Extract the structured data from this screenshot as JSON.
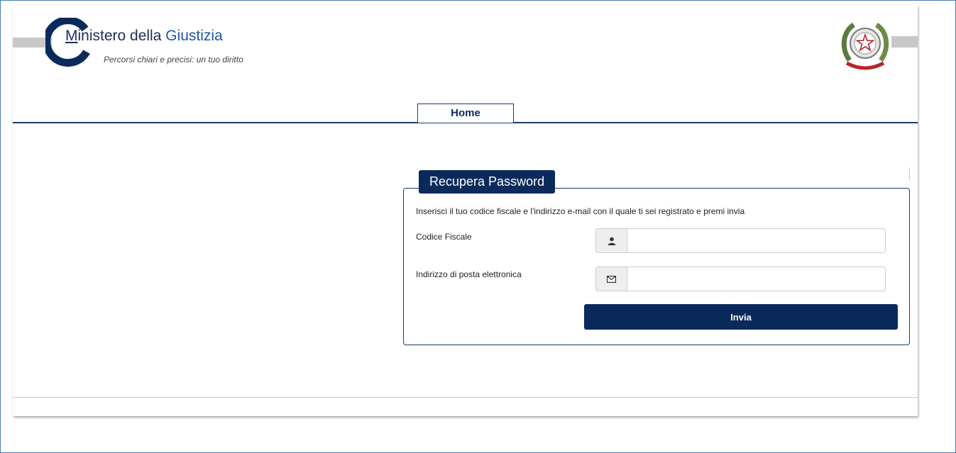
{
  "header": {
    "brand": {
      "title_first": "M",
      "title_rest": "inistero della ",
      "title_accent": "Giustizia",
      "tagline": "Percorsi chiari e precisi: un tuo diritto"
    },
    "emblem_icon": "italian-republic-emblem-icon",
    "logo_icon": "ministry-g-logo-icon"
  },
  "nav": {
    "home_label": "Home"
  },
  "form": {
    "legend": "Recupera Password",
    "instructions": "Inserisci il tuo codice fiscale e l'indirizzo e-mail con il quale ti sei registrato e premi invia",
    "codice_fiscale": {
      "label": "Codice Fiscale",
      "value": "",
      "placeholder": "",
      "icon": "user-icon"
    },
    "email": {
      "label": "Indirizzo di posta elettronica",
      "value": "",
      "placeholder": "",
      "icon": "envelope-icon"
    },
    "submit_label": "Invia"
  },
  "colors": {
    "brand_navy": "#0b2a5c",
    "accent_blue": "#1f56a8",
    "stripe_gray": "#c8c8c8",
    "emblem_green": "#5d7a3e",
    "emblem_red": "#b8242c"
  }
}
